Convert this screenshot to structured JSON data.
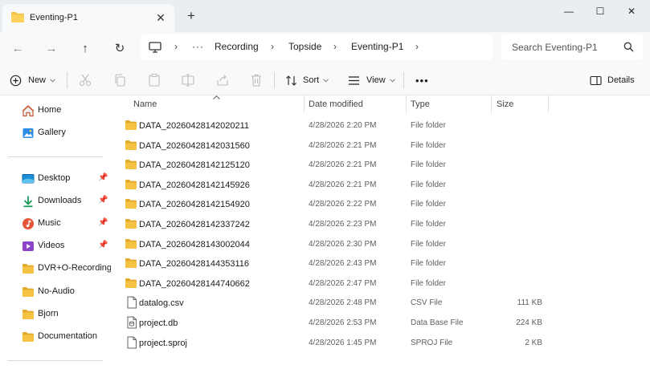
{
  "tab": {
    "title": "Eventing-P1",
    "close_glyph": "✕"
  },
  "new_tab_glyph": "+",
  "window": {
    "minimize": "—",
    "maximize": "☐",
    "close": "✕"
  },
  "nav": {
    "back": "←",
    "forward": "→",
    "up": "↑",
    "refresh": "↻"
  },
  "address": {
    "overflow": "···",
    "separator": "›",
    "crumbs": [
      "Recording",
      "Topside",
      "Eventing-P1"
    ]
  },
  "search": {
    "placeholder": "Search Eventing-P1"
  },
  "toolbar": {
    "new_label": "New",
    "sort_label": "Sort",
    "view_label": "View",
    "more_label": "•••",
    "details_label": "Details"
  },
  "sidebar": {
    "group1": [
      {
        "label": "Home",
        "icon": "home-icon"
      },
      {
        "label": "Gallery",
        "icon": "gallery-icon"
      }
    ],
    "group2": [
      {
        "label": "Desktop",
        "icon": "desktop-icon",
        "pinned": true
      },
      {
        "label": "Downloads",
        "icon": "downloads-icon",
        "pinned": true
      },
      {
        "label": "Music",
        "icon": "music-icon",
        "pinned": true
      },
      {
        "label": "Videos",
        "icon": "videos-icon",
        "pinned": true
      },
      {
        "label": "DVR+O-Recording",
        "icon": "folder-icon",
        "pinned": false
      },
      {
        "label": "No-Audio",
        "icon": "folder-icon",
        "pinned": false
      },
      {
        "label": "Bjorn",
        "icon": "folder-icon",
        "pinned": false
      },
      {
        "label": "Documentation",
        "icon": "folder-icon",
        "pinned": false
      }
    ],
    "pin_glyph": "📌"
  },
  "columns": {
    "name": "Name",
    "date": "Date modified",
    "type": "Type",
    "size": "Size"
  },
  "files": [
    {
      "name": "DATA_20260428142020211",
      "date": "4/28/2026 2:20 PM",
      "type": "File folder",
      "size": "",
      "kind": "folder"
    },
    {
      "name": "DATA_20260428142031560",
      "date": "4/28/2026 2:21 PM",
      "type": "File folder",
      "size": "",
      "kind": "folder"
    },
    {
      "name": "DATA_20260428142125120",
      "date": "4/28/2026 2:21 PM",
      "type": "File folder",
      "size": "",
      "kind": "folder"
    },
    {
      "name": "DATA_20260428142145926",
      "date": "4/28/2026 2:21 PM",
      "type": "File folder",
      "size": "",
      "kind": "folder"
    },
    {
      "name": "DATA_20260428142154920",
      "date": "4/28/2026 2:22 PM",
      "type": "File folder",
      "size": "",
      "kind": "folder"
    },
    {
      "name": "DATA_20260428142337242",
      "date": "4/28/2026 2:23 PM",
      "type": "File folder",
      "size": "",
      "kind": "folder"
    },
    {
      "name": "DATA_20260428143002044",
      "date": "4/28/2026 2:30 PM",
      "type": "File folder",
      "size": "",
      "kind": "folder"
    },
    {
      "name": "DATA_20260428144353116",
      "date": "4/28/2026 2:43 PM",
      "type": "File folder",
      "size": "",
      "kind": "folder"
    },
    {
      "name": "DATA_20260428144740662",
      "date": "4/28/2026 2:47 PM",
      "type": "File folder",
      "size": "",
      "kind": "folder"
    },
    {
      "name": "datalog.csv",
      "date": "4/28/2026 2:48 PM",
      "type": "CSV File",
      "size": "111 KB",
      "kind": "file"
    },
    {
      "name": "project.db",
      "date": "4/28/2026 2:53 PM",
      "type": "Data Base File",
      "size": "224 KB",
      "kind": "dbfile"
    },
    {
      "name": "project.sproj",
      "date": "4/28/2026 1:45 PM",
      "type": "SPROJ File",
      "size": "2 KB",
      "kind": "file"
    }
  ],
  "colors": {
    "folder": "#f5c344",
    "folder_dark": "#e3a92a",
    "accent": "#0067c0"
  }
}
